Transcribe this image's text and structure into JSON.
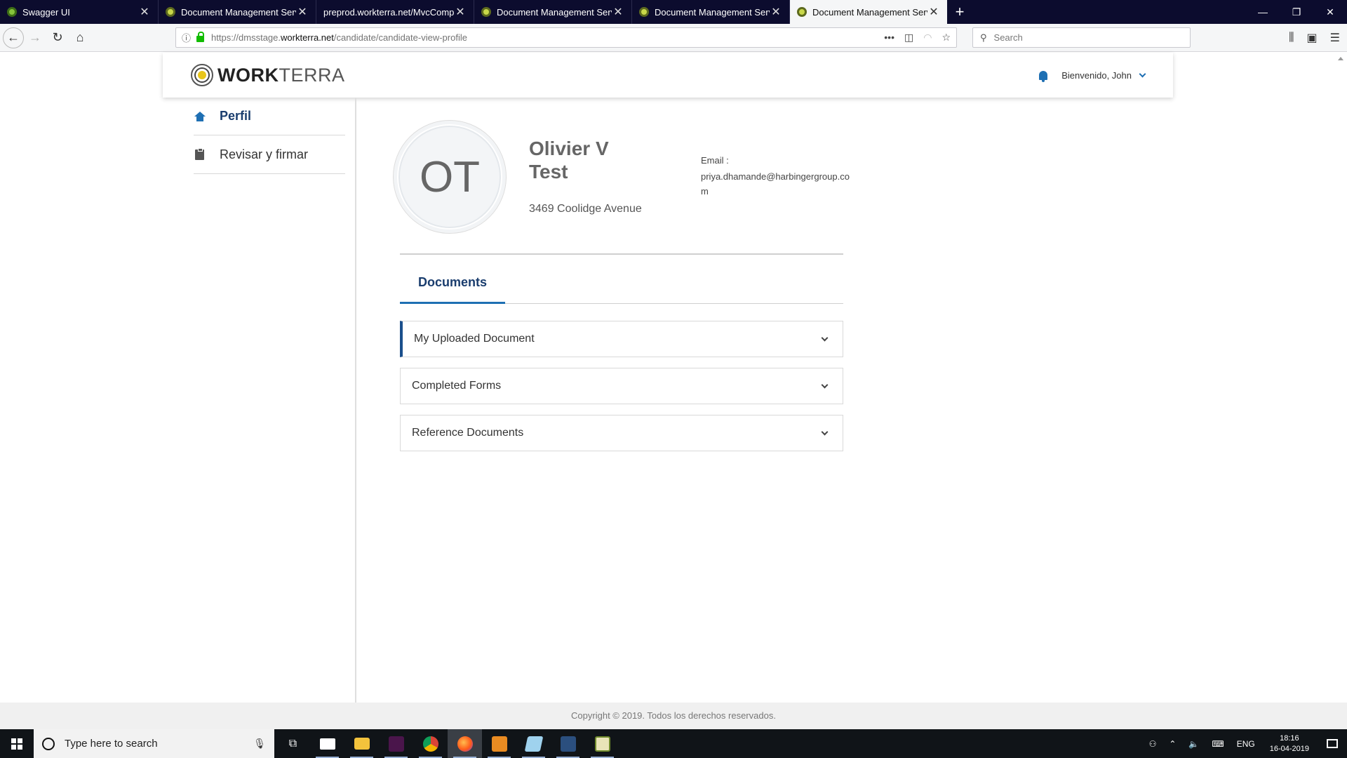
{
  "browser": {
    "tabs": [
      {
        "title": "Swagger UI",
        "active": false
      },
      {
        "title": "Document Management Servic",
        "active": false
      },
      {
        "title": "preprod.workterra.net/MvcCompA",
        "active": false
      },
      {
        "title": "Document Management Servic",
        "active": false
      },
      {
        "title": "Document Management Servic",
        "active": false
      },
      {
        "title": "Document Management Servic",
        "active": true
      }
    ],
    "url_prefix": "https://dmsstage.",
    "url_domain": "workterra.net",
    "url_path": "/candidate/candidate-view-profile",
    "search_placeholder": "Search"
  },
  "header": {
    "logo_bold": "WORK",
    "logo_light": "TERRA",
    "welcome": "Bienvenido, John"
  },
  "sidebar": {
    "items": [
      {
        "label": "Perfil",
        "icon": "home-icon",
        "active": true
      },
      {
        "label": "Revisar y firmar",
        "icon": "clipboard-icon",
        "active": false
      }
    ]
  },
  "profile": {
    "initials": "OT",
    "name_line1": "Olivier V",
    "name_line2": "Test",
    "address": "3469 Coolidge Avenue",
    "email_label": "Email :",
    "email": "priya.dhamande@harbingergroup.com"
  },
  "tabs": {
    "documents": "Documents"
  },
  "accordion": [
    {
      "label": "My Uploaded Document",
      "expanded": true
    },
    {
      "label": "Completed Forms",
      "expanded": false
    },
    {
      "label": "Reference Documents",
      "expanded": false
    }
  ],
  "footer": {
    "copyright": "Copyright © 2019. Todos los derechos reservados."
  },
  "taskbar": {
    "search_placeholder": "Type here to search",
    "lang": "ENG",
    "time": "18:16",
    "date": "16-04-2019"
  },
  "colors": {
    "accent": "#1e6fb3",
    "accent_dark": "#1a3d6e",
    "tabbar_bg": "#0c0c2e"
  }
}
